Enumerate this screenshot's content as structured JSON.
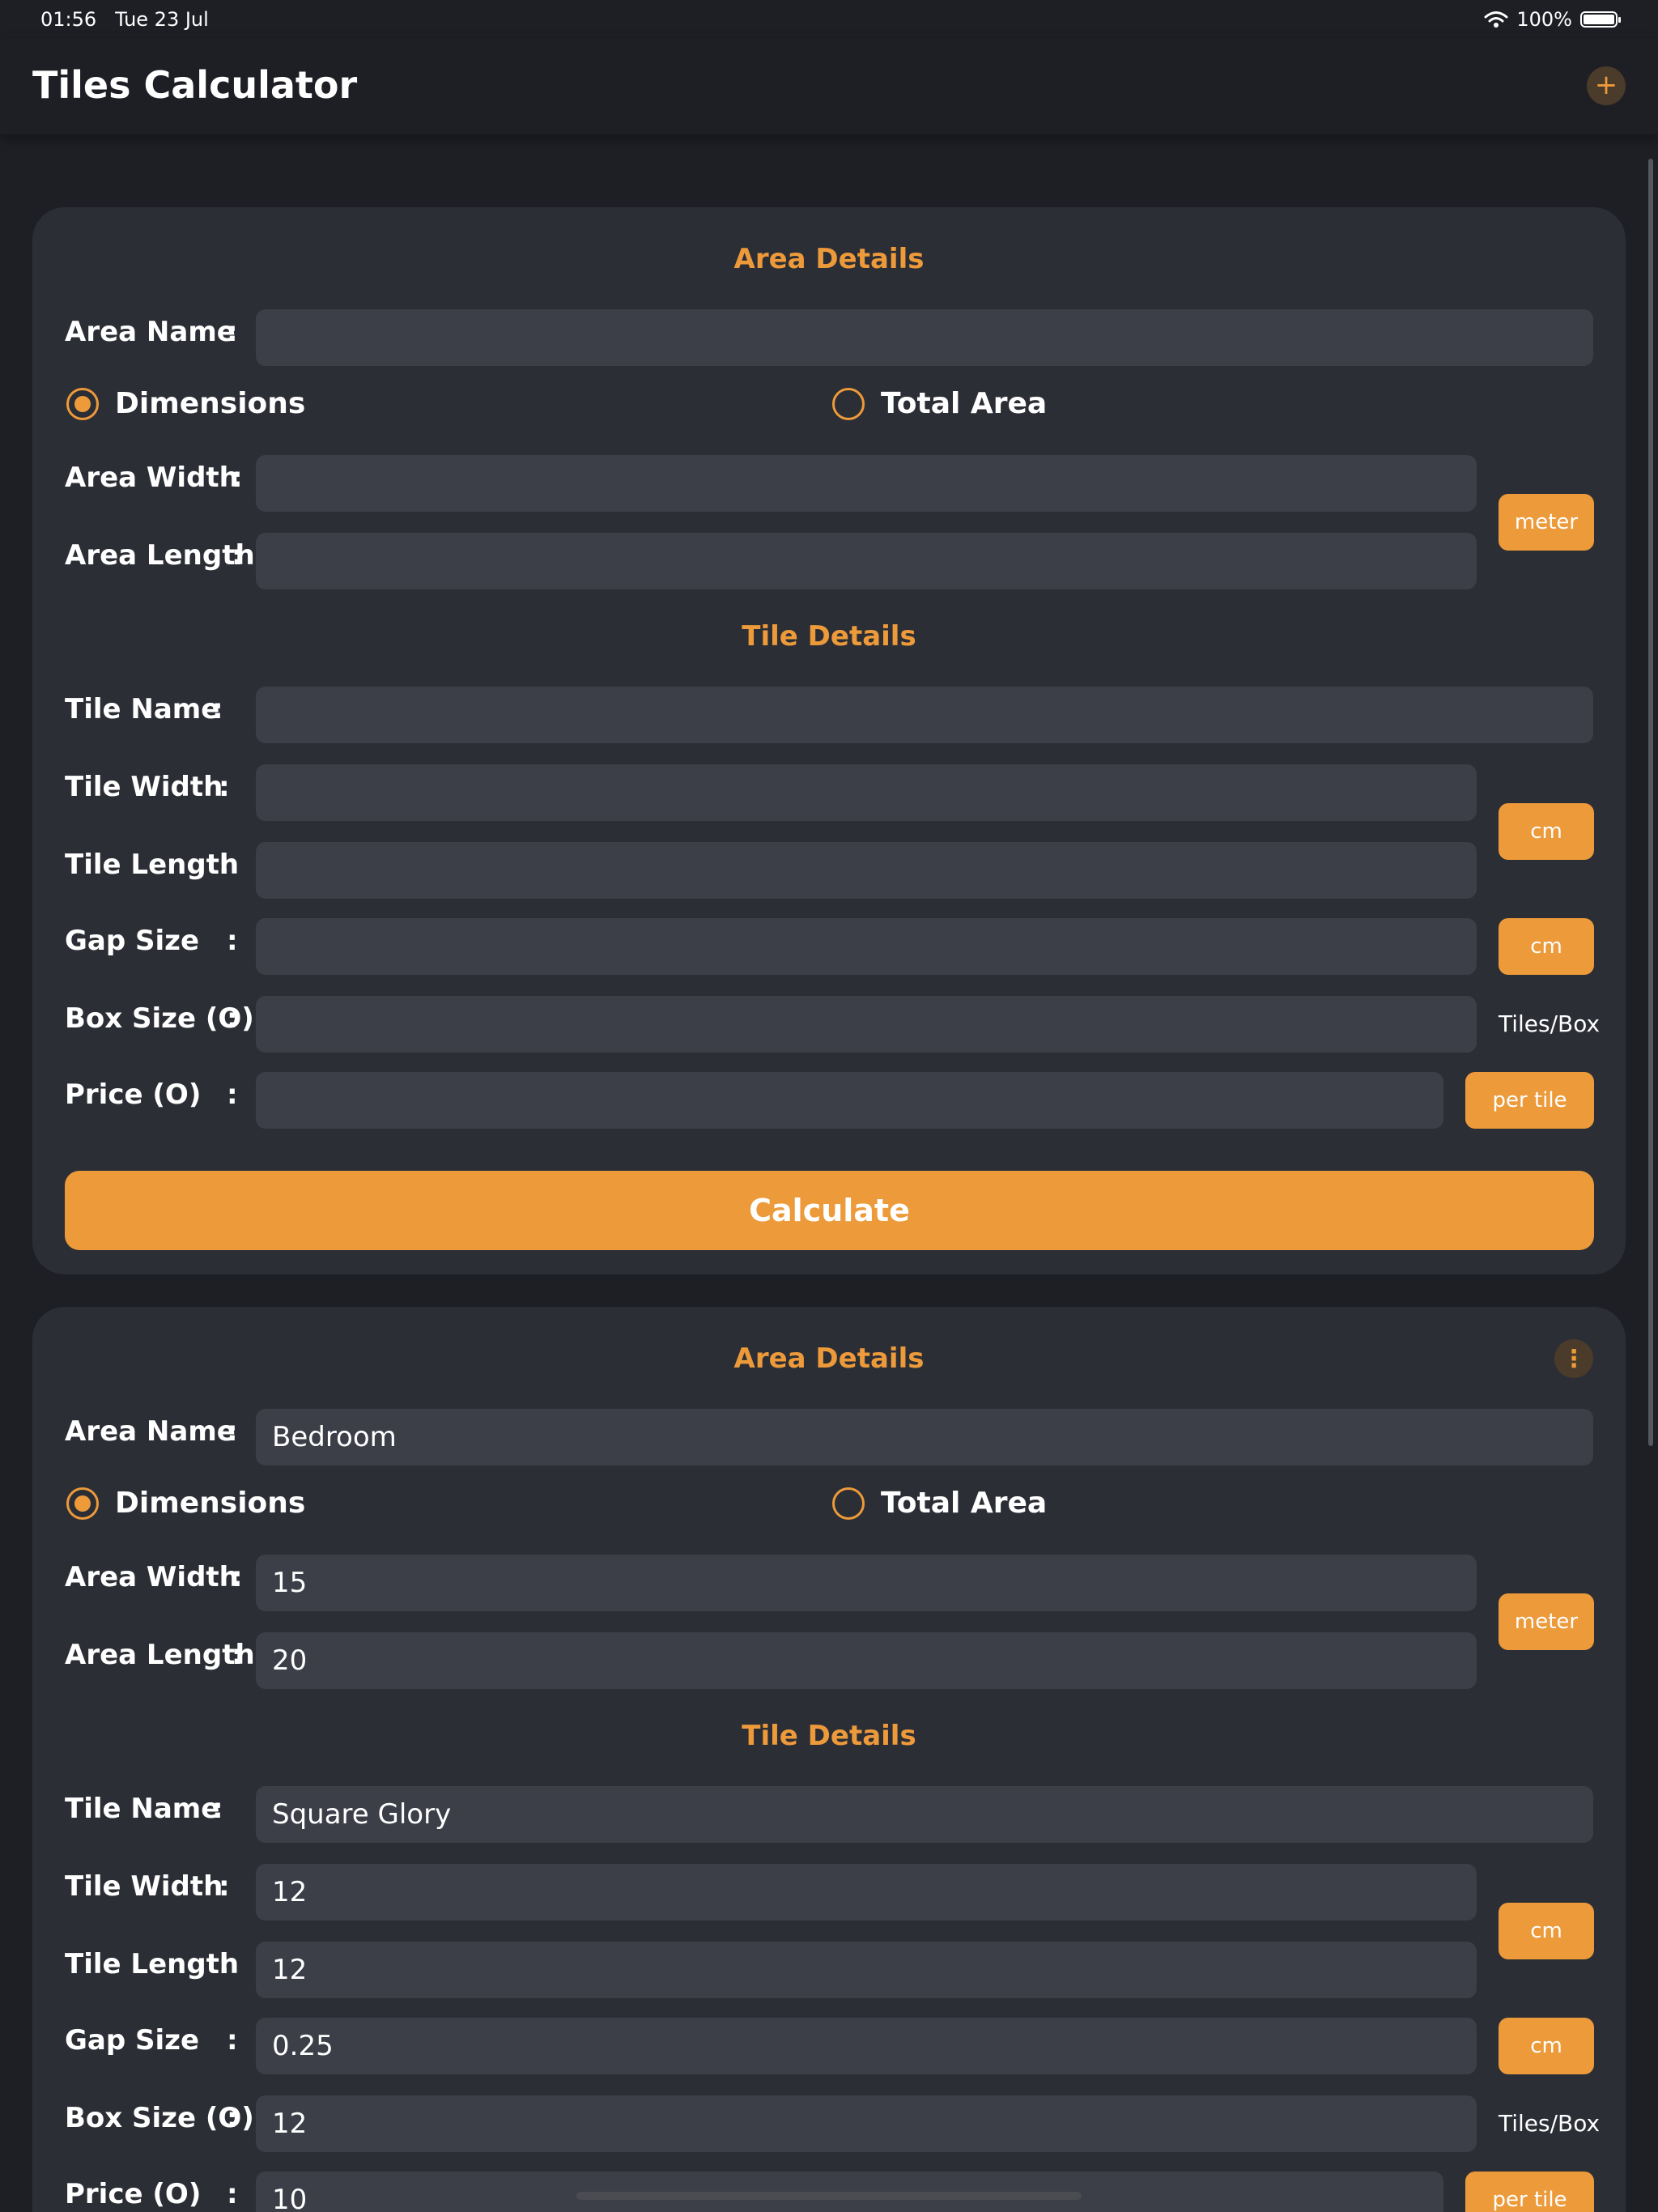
{
  "status_bar": {
    "time": "01:56",
    "date": "Tue 23 Jul",
    "battery": "100%"
  },
  "app": {
    "title": "Tiles Calculator",
    "add_icon": "plus-icon"
  },
  "labels": {
    "area_details": "Area Details",
    "tile_details": "Tile Details",
    "area_name": "Area Name",
    "dimensions": "Dimensions",
    "total_area": "Total Area",
    "area_width": "Area Width",
    "area_length": "Area Length",
    "tile_name": "Tile Name",
    "tile_width": "Tile Width",
    "tile_length": "Tile Length",
    "gap_size": "Gap Size",
    "box_size": "Box Size (O)",
    "price": "Price (O)",
    "colon": ":",
    "calculate": "Calculate"
  },
  "units": {
    "area": "meter",
    "tile": "cm",
    "gap": "cm",
    "box": "Tiles/Box",
    "price": "per tile"
  },
  "form_new": {
    "area_name": "",
    "area_width": "",
    "area_length": "",
    "tile_name": "",
    "tile_width": "",
    "tile_length": "",
    "gap_size": "",
    "box_size": "",
    "price": "",
    "mode": "dimensions"
  },
  "form_saved": {
    "area_name": "Bedroom",
    "area_width": "15",
    "area_length": "20",
    "tile_name": "Square Glory",
    "tile_width": "12",
    "tile_length": "12",
    "gap_size": "0.25",
    "box_size": "12",
    "price": "10",
    "mode": "dimensions"
  },
  "colors": {
    "accent": "#ec9a3a",
    "background": "#1e1f25",
    "card": "#2c2e36",
    "field": "#3c3e48"
  }
}
